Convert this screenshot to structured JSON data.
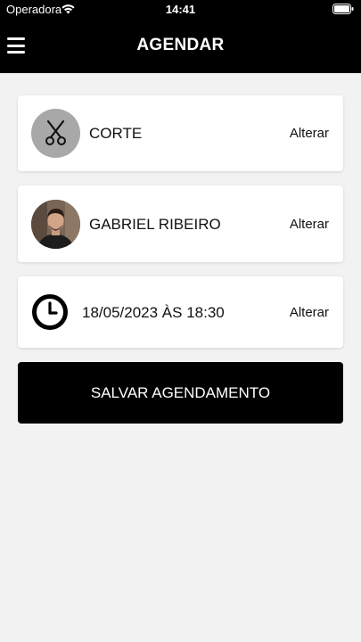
{
  "status_bar": {
    "carrier": "Operadora",
    "time": "14:41",
    "wifi_icon": "wifi-icon",
    "battery_icon": "battery-icon"
  },
  "header": {
    "menu_icon": "hamburger-menu-icon",
    "title": "AGENDAR"
  },
  "service": {
    "icon": "scissors-icon",
    "label": "CORTE",
    "action": "Alterar"
  },
  "barber": {
    "avatar": "barber-photo",
    "label": "GABRIEL RIBEIRO",
    "action": "Alterar"
  },
  "datetime": {
    "icon": "clock-icon",
    "label": "18/05/2023 ÀS 18:30",
    "action": "Alterar"
  },
  "save_button": {
    "label": "SALVAR AGENDAMENTO"
  },
  "colors": {
    "header_bg": "#000000",
    "page_bg": "#f2f2f2",
    "card_bg": "#ffffff",
    "button_bg": "#000000",
    "service_icon_bg": "#a8a8a8"
  }
}
